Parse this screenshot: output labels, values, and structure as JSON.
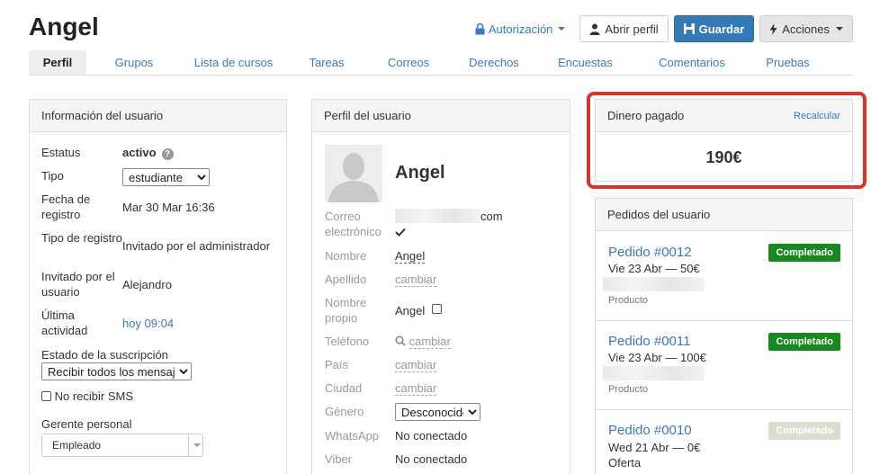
{
  "header": {
    "title": "Angel"
  },
  "toolbar": {
    "authorization": "Autorización",
    "open_profile": "Abrir perfil",
    "save": "Guardar",
    "actions": "Acciones"
  },
  "tabs": [
    "Perfil",
    "Grupos",
    "Lista de cursos",
    "Tareas",
    "Correos",
    "Derechos",
    "Encuestas",
    "Comentarios",
    "Pruebas"
  ],
  "user_info": {
    "title": "Información del usuario",
    "status_label": "Estatus",
    "status_value": "activo",
    "type_label": "Tipo",
    "type_value": "estudiante",
    "reg_date_label": "Fecha de registro",
    "reg_date_value": "Mar 30 Mar 16:36",
    "reg_type_label": "Tipo de registro",
    "reg_type_value": "Invitado por el administrador",
    "invited_by_label": "Invitado por el usuario",
    "invited_by_value": "Alejandro",
    "last_activity_label": "Última actividad",
    "last_activity_value": "hoy 09:04",
    "subscription_label": "Estado de la suscripción",
    "subscription_value": "Recibir todos los mensajes",
    "no_sms_label": "No recibir SMS",
    "manager_label": "Gerente personal",
    "manager_value": "Empleado"
  },
  "profile": {
    "title": "Perfil del usuario",
    "name_display": "Angel",
    "email_label": "Correo electrónico",
    "email_suffix": "com",
    "first_name_label": "Nombre",
    "first_name_value": "Angel",
    "last_name_label": "Apellido",
    "change": "cambiar",
    "own_name_label": "Nombre propio",
    "own_name_value": "Angel",
    "phone_label": "Teléfono",
    "country_label": "País",
    "city_label": "Ciudad",
    "gender_label": "Género",
    "gender_value": "Desconocido",
    "whatsapp_label": "WhatsApp",
    "whatsapp_value": "No conectado",
    "viber_label": "Viber",
    "viber_value": "No conectado"
  },
  "money": {
    "title": "Dinero pagado",
    "recalc": "Recalcular",
    "amount": "190€"
  },
  "orders": {
    "title": "Pedidos del usuario",
    "items": [
      {
        "id": "Pedido #0012",
        "line": "Vie 23 Abr — 50€",
        "note": "Producto",
        "status": "Completado"
      },
      {
        "id": "Pedido #0011",
        "line": "Vie 23 Abr — 100€",
        "note": "Producto",
        "status": "Completado"
      },
      {
        "id": "Pedido #0010",
        "line": "Wed 21 Abr — 0€",
        "note": "Oferta",
        "status": "Completado"
      }
    ]
  },
  "colors": {
    "accent": "#337ab7",
    "link": "#3a78c3",
    "success": "#18891f",
    "highlight": "#d9342b"
  }
}
